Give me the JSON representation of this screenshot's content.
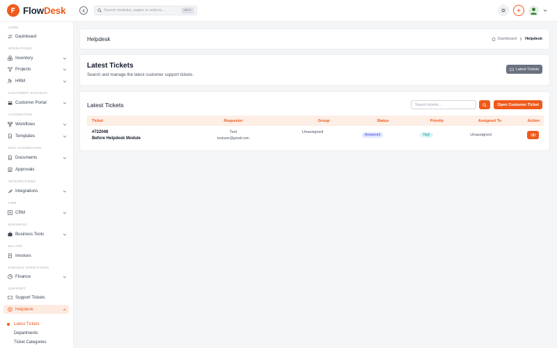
{
  "app": {
    "brand_part1": "Flow",
    "brand_part2": "Desk",
    "accent_color": "#ef5a1c"
  },
  "topbar": {
    "search_placeholder": "Search modules, pages or actions...",
    "search_shortcut": "Ctrl K"
  },
  "sidebar": {
    "sections": {
      "core": "CORE",
      "operations": "OPERATIONS",
      "customer_success": "CUSTOMER SUCCESS",
      "automation": "AUTOMATION",
      "doc_automation": "DOC AUTOMATION",
      "integrations": "INTEGRATIONS",
      "crm": "CRM",
      "business": "BUSINESS",
      "billing": "BILLING",
      "finance_operations": "FINANCE OPERATIONS",
      "support": "SUPPORT"
    },
    "items": {
      "dashboard": "Dashboard",
      "inventory": "Inventory",
      "projects": "Projects",
      "hrm": "HRM",
      "customer_portal": "Customer Portal",
      "workflows": "Workflows",
      "templates": "Templates",
      "documents": "Documents",
      "approvals": "Approvals",
      "integrations": "Integrations",
      "crm": "CRM",
      "business_tools": "Business Tools",
      "invoices": "Invoices",
      "finance": "Finance",
      "support_tickets": "Support Tickets",
      "helpdesk": "Helpdesk"
    },
    "helpdesk_sub": {
      "latest_tickets": "Latest Tickets",
      "departments": "Departments",
      "ticket_categories": "Ticket Categories"
    }
  },
  "header": {
    "title": "Helpdesk",
    "breadcrumb_home": "Dashboard",
    "breadcrumb_current": "Helpdesk"
  },
  "intro": {
    "title": "Latest Tickets",
    "subtitle": "Search and manage the latest customer support tickets.",
    "button_label": "Latest Tickets"
  },
  "tickets": {
    "title": "Latest Tickets",
    "search_placeholder": "Search tickets...",
    "open_button": "Open Customer Ticket",
    "columns": {
      "ticket": "Ticket",
      "requester": "Requester",
      "group": "Group",
      "status": "Status",
      "priority": "Priority",
      "assigned_to": "Assigned To",
      "action": "Action"
    },
    "rows": [
      {
        "id": "#722048",
        "subject": "Before Helpdesk Module",
        "requester_name": "Test",
        "requester_email": "testuser@gmail.com",
        "group": "Unassigned",
        "status": "Answered",
        "priority": "High",
        "assigned_to": "Unassigned"
      }
    ]
  }
}
